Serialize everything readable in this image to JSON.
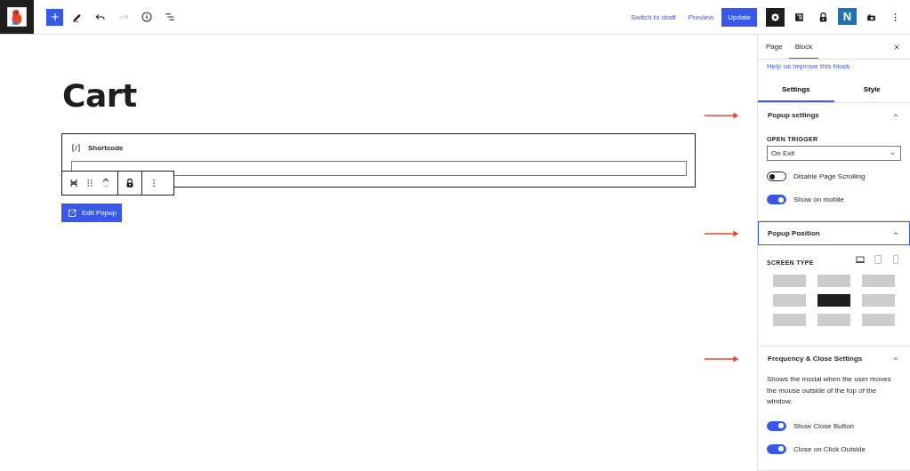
{
  "toolbar": {
    "tools": [
      {
        "kind": "inserter",
        "pressed": true
      },
      {
        "kind": "tools",
        "pressed": false
      },
      {
        "kind": "undo",
        "disabled": false
      },
      {
        "kind": "redo",
        "disabled": true
      },
      {
        "kind": "details",
        "disabled": false
      },
      {
        "kind": "list-view",
        "disabled": false
      }
    ],
    "switch_to_draft": "Switch to draft",
    "preview": "Preview",
    "update": "Update",
    "plugins": [
      {
        "kind": "settings",
        "selected": true
      },
      {
        "kind": "square",
        "selected": false
      },
      {
        "kind": "lock",
        "selected": false
      },
      {
        "kind": "letter",
        "label": "N",
        "selected": false
      },
      {
        "kind": "camera",
        "selected": false
      },
      {
        "kind": "options",
        "selected": false
      }
    ]
  },
  "canvas": {
    "title": "Cart",
    "block": {
      "label": "Shortcode"
    },
    "edit_button": "Edit Popup"
  },
  "sidebar": {
    "tabs": [
      {
        "label": "Page",
        "selected": false
      },
      {
        "label": "Block",
        "selected": true
      }
    ],
    "help_link": "Help us improve this block",
    "sub_tabs": [
      {
        "label": "Settings",
        "selected": true
      },
      {
        "label": "Style",
        "selected": false
      }
    ],
    "sections": [
      {
        "title": "Popup settings",
        "expanded": true,
        "focused": false,
        "annotated": true,
        "controls": [
          {
            "kind": "select",
            "label": "OPEN TRIGGER",
            "value": "On Exit"
          },
          {
            "kind": "toggle",
            "label": "Disable Page Scrolling",
            "on": false
          },
          {
            "kind": "toggle",
            "label": "Show on mobile",
            "on": true
          }
        ]
      },
      {
        "title": "Popup Position",
        "expanded": true,
        "focused": true,
        "annotated": true,
        "controls": [
          {
            "kind": "position",
            "label": "SCREEN TYPE",
            "devices": [
              {
                "kind": "desktop",
                "selected": true
              },
              {
                "kind": "tablet",
                "selected": false
              },
              {
                "kind": "mobile",
                "selected": false
              }
            ],
            "cells": [
              {
                "selected": false
              },
              {
                "selected": false
              },
              {
                "selected": false
              },
              {
                "selected": false
              },
              {
                "selected": true
              },
              {
                "selected": false
              },
              {
                "selected": false
              },
              {
                "selected": false
              },
              {
                "selected": false
              }
            ]
          }
        ]
      },
      {
        "title": "Frequency & Close Settings",
        "expanded": true,
        "focused": false,
        "annotated": true,
        "controls": [
          {
            "kind": "text",
            "text": "Shows the modal when the user moves the mouse outside of the top of the window."
          },
          {
            "kind": "toggle",
            "label": "Show Close Button",
            "on": true
          },
          {
            "kind": "toggle",
            "label": "Close on Click Outside",
            "on": true
          }
        ]
      }
    ]
  }
}
